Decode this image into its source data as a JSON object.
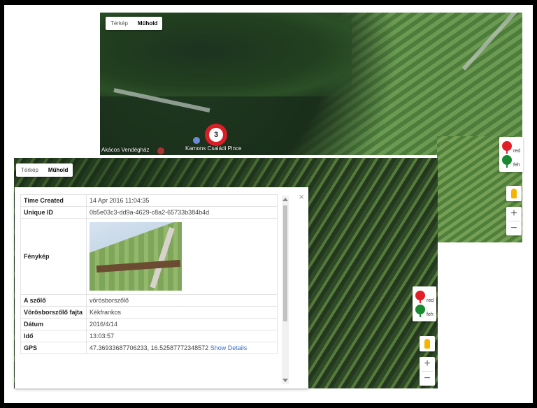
{
  "top_map": {
    "map_type": {
      "map": "Térkép",
      "satellite": "Műhold",
      "selected": "Műhold"
    },
    "marker_count": "3",
    "labels": {
      "restaurant": "Akácos Vendégház",
      "winery": "Kamons Családi Pince"
    }
  },
  "main_map": {
    "map_type": {
      "map": "Térkép",
      "satellite": "Műhold",
      "selected": "Műhold"
    }
  },
  "legend": [
    {
      "label": "red",
      "color": "#e21f26"
    },
    {
      "label": "feh",
      "color": "#1a8a2e"
    }
  ],
  "zoom": {
    "in": "+",
    "out": "−"
  },
  "info_window": {
    "close": "×",
    "rows": [
      {
        "key": "Time Created",
        "value": "14 Apr 2016 11:04:35"
      },
      {
        "key": "Unique ID",
        "value": "0b5e03c3-dd9a-4629-c8a2-65733b384b4d"
      },
      {
        "key": "Fénykép",
        "value": ""
      },
      {
        "key": "A szőlő",
        "value": "vörösborszőlő"
      },
      {
        "key": "Vörösborszőlő fajta",
        "value": "Kékfrankos"
      },
      {
        "key": "Dátum",
        "value": "2016/4/14"
      },
      {
        "key": "Idő",
        "value": "13:03:57"
      },
      {
        "key": "GPS",
        "value": "47.36933687706233, 16.52587772348572",
        "link": "Show Details"
      }
    ]
  }
}
